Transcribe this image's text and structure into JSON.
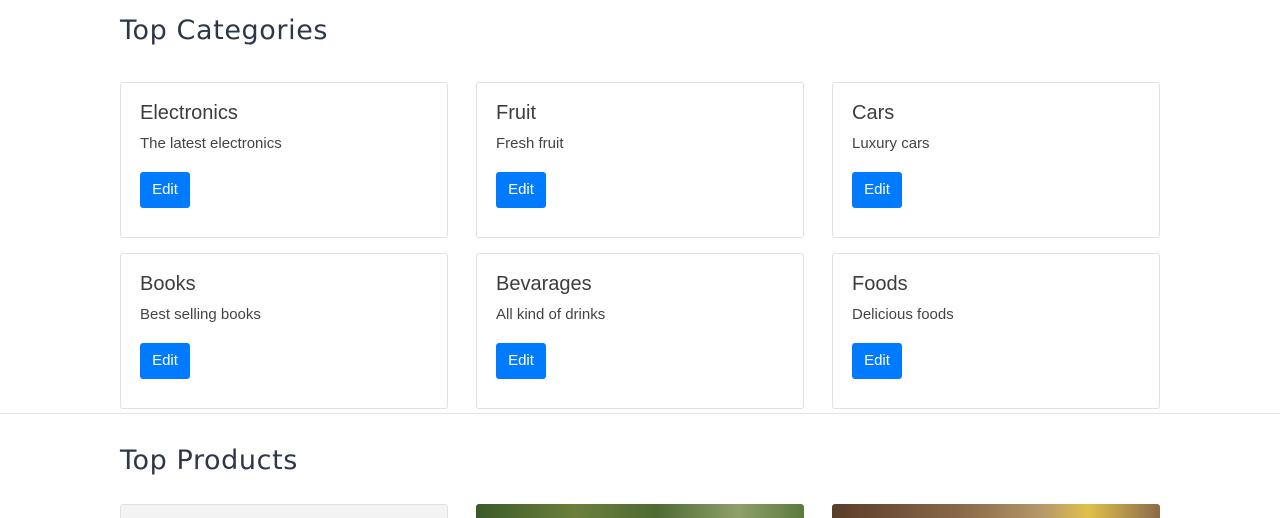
{
  "sections": {
    "categories_title": "Top Categories",
    "products_title": "Top Products"
  },
  "categories": [
    {
      "title": "Electronics",
      "description": "The latest electronics",
      "button": "Edit"
    },
    {
      "title": "Fruit",
      "description": "Fresh fruit",
      "button": "Edit"
    },
    {
      "title": "Cars",
      "description": "Luxury cars",
      "button": "Edit"
    },
    {
      "title": "Books",
      "description": "Best selling books",
      "button": "Edit"
    },
    {
      "title": "Bevarages",
      "description": "All kind of drinks",
      "button": "Edit"
    },
    {
      "title": "Foods",
      "description": "Delicious foods",
      "button": "Edit"
    }
  ],
  "colors": {
    "primary": "#007bff",
    "border": "#dee2e6",
    "heading": "#2d3748"
  }
}
